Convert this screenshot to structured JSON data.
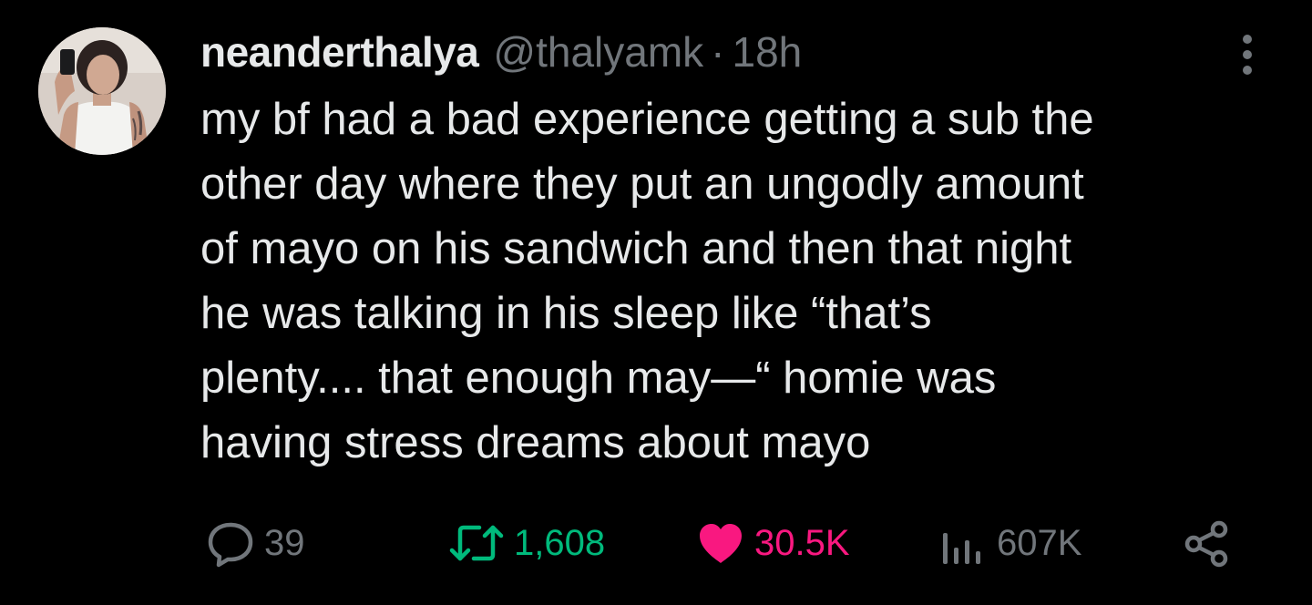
{
  "tweet": {
    "author": {
      "display_name": "neanderthalya",
      "handle": "@thalyamk",
      "separator": "·",
      "time_ago": "18h"
    },
    "text": "my bf had a bad experience getting a sub the\nother day where they put an ungodly amount\nof mayo on his sandwich and then that night\nhe was talking in his sleep like “that’s\nplenty.... that enough may—“ homie was\nhaving stress dreams about mayo",
    "metrics": {
      "replies": "39",
      "retweets": "1,608",
      "likes": "30.5K",
      "views": "607K"
    },
    "liked": true
  },
  "colors": {
    "background": "#000000",
    "primary_text": "#e7e9ea",
    "secondary_text": "#71767b",
    "retweet_green": "#00ba7c",
    "like_pink": "#f91880"
  },
  "icons": {
    "more": "vertical-ellipsis-icon",
    "reply": "speech-bubble-icon",
    "retweet": "retweet-arrows-icon",
    "like": "heart-filled-icon",
    "views": "bar-chart-icon",
    "share": "share-nodes-icon"
  }
}
